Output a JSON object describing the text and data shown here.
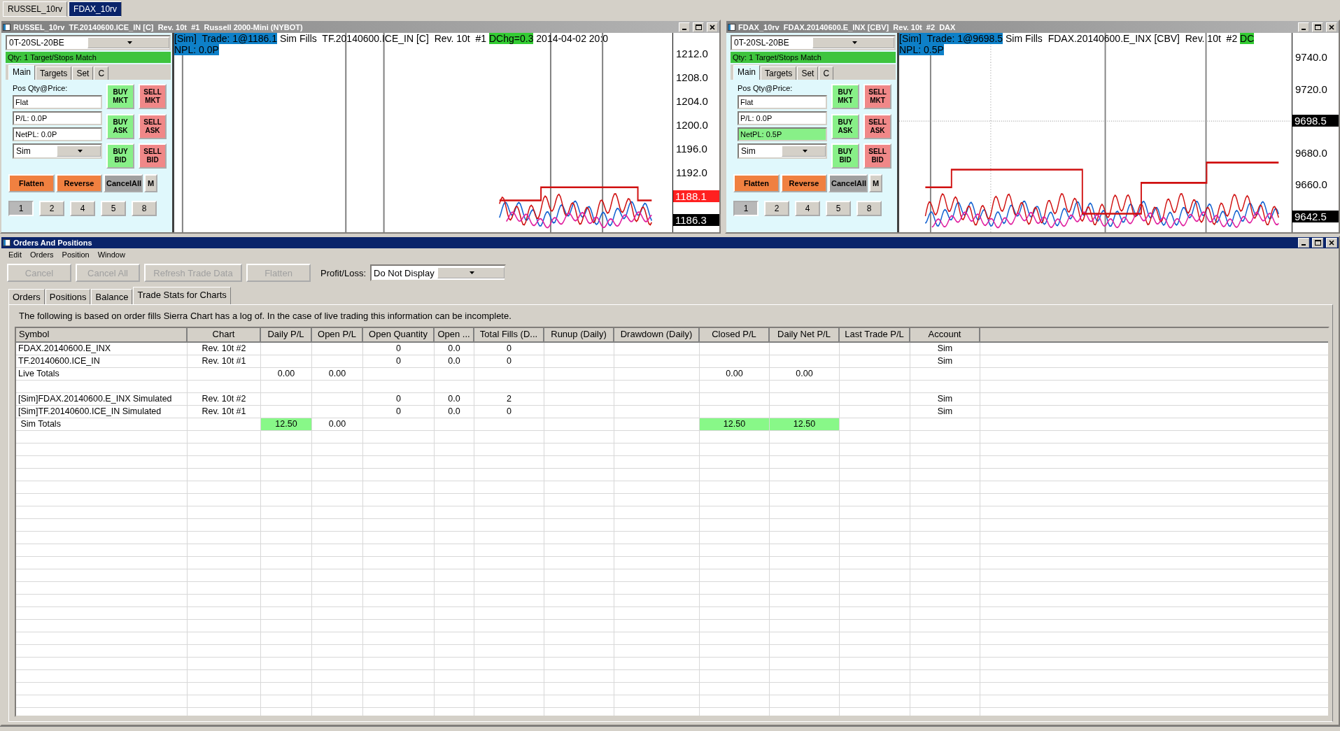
{
  "workspace_tabs": [
    {
      "label": "RUSSEL_10rv",
      "selected": false
    },
    {
      "label": "FDAX_10rv",
      "selected": true
    }
  ],
  "chart_windows": [
    {
      "title": "RUSSEL_10rv  TF.20140600.ICE_IN [C]  Rev. 10t  #1  Russell 2000-Mini (NYBOT)",
      "trade_panel": {
        "strategy": "0T-20SL-20BE",
        "status": "Qty: 1 Target/Stops Match",
        "tabs": [
          {
            "label": "Main",
            "selected": true
          },
          {
            "label": "Targets",
            "selected": false
          },
          {
            "label": "Set",
            "selected": false
          },
          {
            "label": "C",
            "selected": false
          }
        ],
        "position_label": "Pos Qty@Price:",
        "fields": [
          {
            "value": "Flat",
            "highlighted": false
          },
          {
            "value": "P/L: 0.0P",
            "highlighted": false
          },
          {
            "value": "NetPL: 0.0P",
            "highlighted": false
          }
        ],
        "account": "Sim",
        "order_buttons": [
          {
            "label": "BUY MKT",
            "kind": "buy"
          },
          {
            "label": "SELL MKT",
            "kind": "sell"
          },
          {
            "label": "BUY ASK",
            "kind": "buy"
          },
          {
            "label": "SELL ASK",
            "kind": "sell"
          },
          {
            "label": "BUY BID",
            "kind": "buy"
          },
          {
            "label": "SELL BID",
            "kind": "sell"
          }
        ],
        "action_buttons": [
          {
            "label": "Flatten",
            "kind": "action"
          },
          {
            "label": "Reverse",
            "kind": "action"
          },
          {
            "label": "CancelAll",
            "kind": "cancel"
          },
          {
            "label": "M",
            "kind": "small"
          }
        ],
        "quantity_buttons": [
          {
            "label": "1",
            "selected": true
          },
          {
            "label": "2",
            "selected": false
          },
          {
            "label": "4",
            "selected": false
          },
          {
            "label": "5",
            "selected": false
          },
          {
            "label": "8",
            "selected": false
          }
        ]
      },
      "header_lines": [
        [
          {
            "text": "[Sim]  Trade: 1@1186.1",
            "color": "#0e80c8"
          },
          {
            "text": " Sim Fills  TF.20140600.ICE_IN [C]  Rev. 10t  #1 "
          },
          {
            "text": "DChg=0.3",
            "color": "#33cc33"
          },
          {
            "text": " 2014-04-02 20:0"
          }
        ],
        [
          {
            "text": "NPL: 0.0P",
            "color": "#0e80c8"
          }
        ]
      ],
      "price_axis": [
        {
          "text": "1212.0",
          "kind": "tick"
        },
        {
          "text": "1208.0",
          "kind": "tick"
        },
        {
          "text": "1204.0",
          "kind": "tick"
        },
        {
          "text": "1200.0",
          "kind": "tick"
        },
        {
          "text": "1196.0",
          "kind": "tick"
        },
        {
          "text": "1192.0",
          "kind": "tick"
        },
        {
          "text": "1188.1",
          "kind": "marker",
          "color": "#ff2020"
        },
        {
          "text": "1186.3",
          "kind": "marker",
          "color": "#000000"
        }
      ]
    },
    {
      "title": "FDAX_10rv  FDAX.20140600.E_INX [CBV]  Rev. 10t  #2  DAX",
      "trade_panel": {
        "strategy": "0T-20SL-20BE",
        "status": "Qty: 1 Target/Stops Match",
        "tabs": [
          {
            "label": "Main",
            "selected": true
          },
          {
            "label": "Targets",
            "selected": false
          },
          {
            "label": "Set",
            "selected": false
          },
          {
            "label": "C",
            "selected": false
          }
        ],
        "position_label": "Pos Qty@Price:",
        "fields": [
          {
            "value": "Flat",
            "highlighted": false
          },
          {
            "value": "P/L: 0.0P",
            "highlighted": false
          },
          {
            "value": "NetPL: 0.5P",
            "highlighted": true
          }
        ],
        "account": "Sim",
        "order_buttons": [
          {
            "label": "BUY MKT",
            "kind": "buy"
          },
          {
            "label": "SELL MKT",
            "kind": "sell"
          },
          {
            "label": "BUY ASK",
            "kind": "buy"
          },
          {
            "label": "SELL ASK",
            "kind": "sell"
          },
          {
            "label": "BUY BID",
            "kind": "buy"
          },
          {
            "label": "SELL BID",
            "kind": "sell"
          }
        ],
        "action_buttons": [
          {
            "label": "Flatten",
            "kind": "action"
          },
          {
            "label": "Reverse",
            "kind": "action"
          },
          {
            "label": "CancelAll",
            "kind": "cancel"
          },
          {
            "label": "M",
            "kind": "small"
          }
        ],
        "quantity_buttons": [
          {
            "label": "1",
            "selected": true
          },
          {
            "label": "2",
            "selected": false
          },
          {
            "label": "4",
            "selected": false
          },
          {
            "label": "5",
            "selected": false
          },
          {
            "label": "8",
            "selected": false
          }
        ]
      },
      "header_lines": [
        [
          {
            "text": "[Sim]  Trade: 1@9698.5",
            "color": "#0e80c8"
          },
          {
            "text": " Sim Fills  FDAX.20140600.E_INX [CBV]  Rev. 10t  #2 "
          },
          {
            "text": "DC",
            "color": "#33cc33"
          }
        ],
        [
          {
            "text": "NPL: 0.5P",
            "color": "#0e80c8"
          }
        ]
      ],
      "price_axis": [
        {
          "text": "9740.0",
          "kind": "tick"
        },
        {
          "text": "9720.0",
          "kind": "tick"
        },
        {
          "text": "9698.5",
          "kind": "marker",
          "color": "#000000"
        },
        {
          "text": "9680.0",
          "kind": "tick"
        },
        {
          "text": "9660.0",
          "kind": "tick"
        },
        {
          "text": "9642.5",
          "kind": "marker",
          "color": "#000000"
        }
      ]
    }
  ],
  "orders_window": {
    "title": "Orders And Positions",
    "menu": [
      "Edit",
      "Orders",
      "Position",
      "Window"
    ],
    "toolbar_buttons": [
      {
        "label": "Cancel",
        "disabled": true
      },
      {
        "label": "Cancel All",
        "disabled": true
      },
      {
        "label": "Refresh Trade Data",
        "disabled": true
      },
      {
        "label": "Flatten",
        "disabled": true
      }
    ],
    "profit_loss_label": "Profit/Loss:",
    "profit_loss_value": "Do Not Display",
    "tabs": [
      {
        "label": "Orders",
        "selected": false
      },
      {
        "label": "Positions",
        "selected": false
      },
      {
        "label": "Balance",
        "selected": false
      },
      {
        "label": "Trade Stats for Charts",
        "selected": true
      }
    ],
    "info": "The following is based on order fills Sierra Chart has a log of.  In the case of live trading this information can be incomplete.",
    "table": {
      "columns": [
        "Symbol",
        "Chart",
        "Daily P/L",
        "Open P/L",
        "Open Quantity",
        "Open ...",
        "Total Fills (D...",
        "Runup (Daily)",
        "Drawdown (Daily)",
        "Closed P/L",
        "Daily Net P/L",
        "Last Trade P/L",
        "Account"
      ],
      "rows": [
        {
          "cells": [
            "FDAX.20140600.E_INX",
            "Rev. 10t #2",
            "",
            "",
            "0",
            "0.0",
            "0",
            "",
            "",
            "",
            "",
            "",
            "Sim"
          ]
        },
        {
          "cells": [
            "TF.20140600.ICE_IN",
            "Rev. 10t #1",
            "",
            "",
            "0",
            "0.0",
            "0",
            "",
            "",
            "",
            "",
            "",
            "Sim"
          ]
        },
        {
          "cells": [
            "Live Totals",
            "",
            "0.00",
            "0.00",
            "",
            "",
            "",
            "",
            "",
            "0.00",
            "0.00",
            "",
            ""
          ]
        },
        {
          "cells": [
            "",
            "",
            "",
            "",
            "",
            "",
            "",
            "",
            "",
            "",
            "",
            "",
            ""
          ]
        },
        {
          "cells": [
            "[Sim]FDAX.20140600.E_INX Simulated",
            "Rev. 10t #2",
            "",
            "",
            "0",
            "0.0",
            "2",
            "",
            "",
            "",
            "",
            "",
            "Sim"
          ]
        },
        {
          "cells": [
            "[Sim]TF.20140600.ICE_IN Simulated",
            "Rev. 10t #1",
            "",
            "",
            "0",
            "0.0",
            "0",
            "",
            "",
            "",
            "",
            "",
            "Sim"
          ]
        },
        {
          "cells": [
            " Sim Totals",
            "",
            {
              "text": "12.50",
              "highlighted": true
            },
            "0.00",
            "",
            "",
            "",
            "",
            "",
            {
              "text": "12.50",
              "highlighted": true
            },
            {
              "text": "12.50",
              "highlighted": true
            },
            "",
            ""
          ]
        }
      ]
    }
  }
}
